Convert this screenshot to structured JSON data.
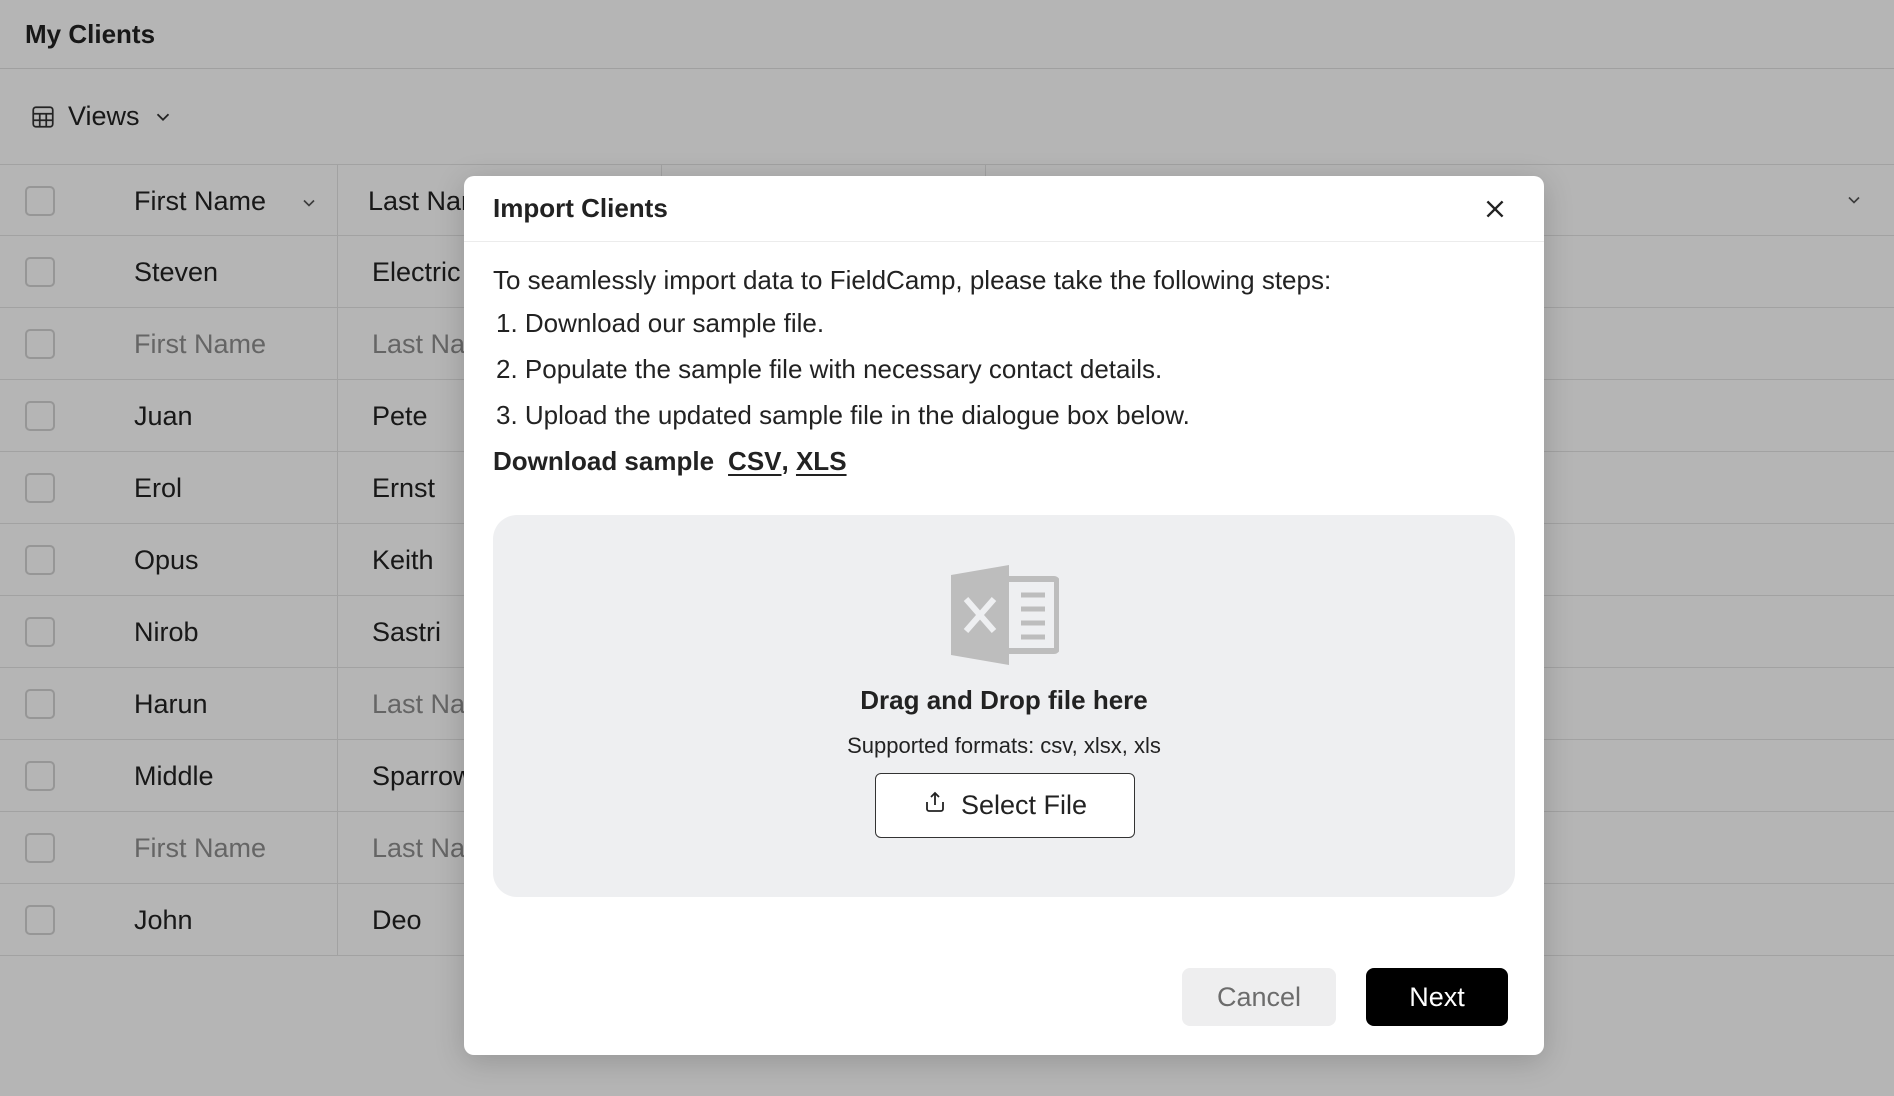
{
  "page": {
    "title": "My Clients"
  },
  "toolbar": {
    "views_label": "Views",
    "views_icon": "table-grid-icon"
  },
  "table": {
    "headers": {
      "first_name": "First Name",
      "last_name": "Last Name"
    },
    "rows": [
      {
        "first": "Steven",
        "last": "Electric",
        "first_placeholder": false,
        "last_placeholder": false
      },
      {
        "first": "First Name",
        "last": "Last Name",
        "first_placeholder": true,
        "last_placeholder": true
      },
      {
        "first": "Juan",
        "last": "Pete",
        "first_placeholder": false,
        "last_placeholder": false
      },
      {
        "first": "Erol",
        "last": "Ernst",
        "first_placeholder": false,
        "last_placeholder": false
      },
      {
        "first": "Opus",
        "last": "Keith",
        "first_placeholder": false,
        "last_placeholder": false
      },
      {
        "first": "Nirob",
        "last": "Sastri",
        "first_placeholder": false,
        "last_placeholder": false
      },
      {
        "first": "Harun",
        "last": "Last Name",
        "first_placeholder": false,
        "last_placeholder": true
      },
      {
        "first": "Middle",
        "last": "Sparrow",
        "first_placeholder": false,
        "last_placeholder": false
      },
      {
        "first": "First Name",
        "last": "Last Name",
        "first_placeholder": true,
        "last_placeholder": true
      },
      {
        "first": "John",
        "last": "Deo",
        "first_placeholder": false,
        "last_placeholder": false
      }
    ]
  },
  "modal": {
    "title": "Import Clients",
    "intro": "To seamlessly import data to FieldCamp, please take the following steps:",
    "steps": [
      "1. Download our sample file.",
      "2. Populate the sample file with necessary contact details.",
      "3. Upload the updated sample file in the dialogue box below."
    ],
    "download_label": "Download sample",
    "csv_link": "CSV",
    "link_separator": ", ",
    "xls_link": "XLS",
    "dropzone": {
      "icon": "excel-file-icon",
      "title": "Drag and Drop file here",
      "formats": "Supported formats: csv, xlsx, xls",
      "select_label": "Select File"
    },
    "cancel_label": "Cancel",
    "next_label": "Next"
  }
}
